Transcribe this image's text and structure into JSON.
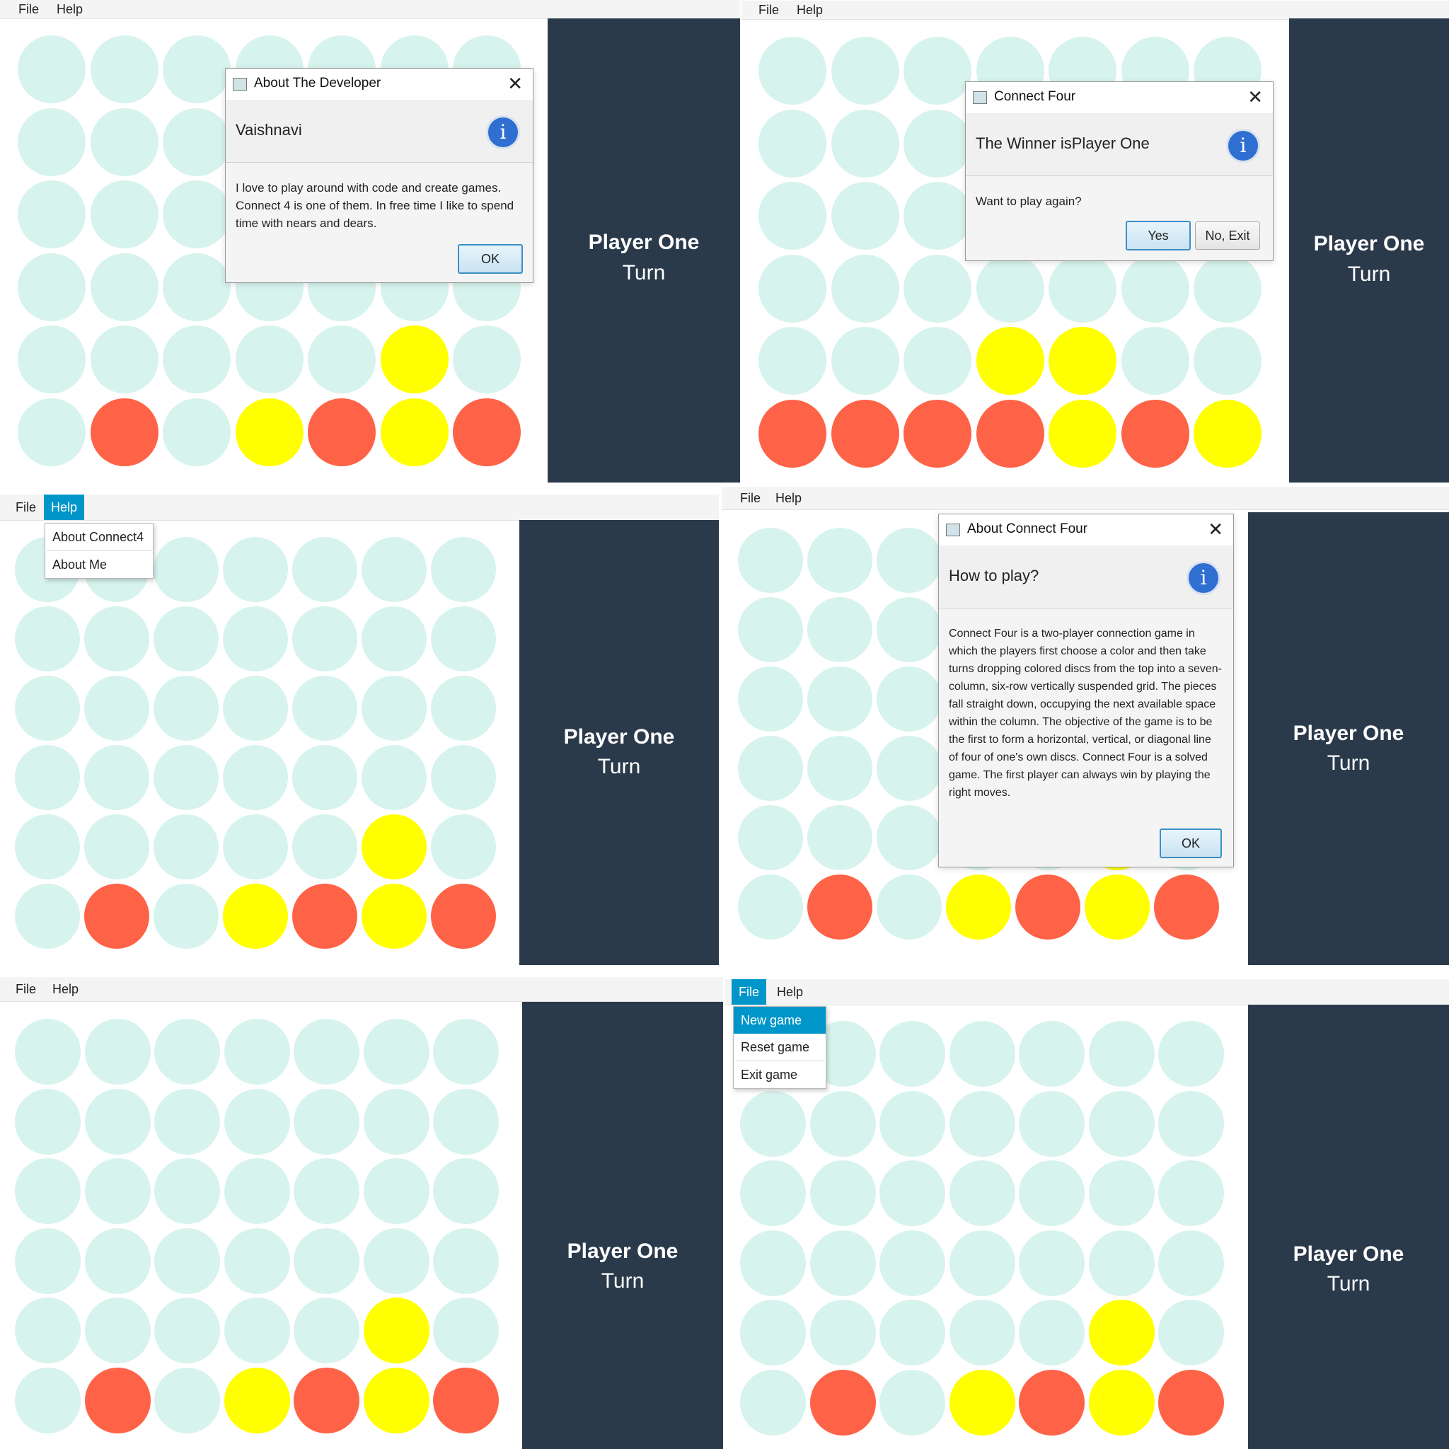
{
  "menus": {
    "file": "File",
    "help": "Help"
  },
  "sidebar": {
    "player": "Player One",
    "turn": "Turn"
  },
  "window_title": "Connect Four",
  "colors": {
    "empty": "#d7f3ee",
    "red": "#ff6347",
    "yellow": "#ffff00",
    "sidebar": "#2b3a4b",
    "accent": "#0096c9"
  },
  "boards": {
    "a": [
      [
        "e",
        "e",
        "e",
        "e",
        "e",
        "e",
        "e"
      ],
      [
        "e",
        "e",
        "e",
        "e",
        "e",
        "e",
        "e"
      ],
      [
        "e",
        "e",
        "e",
        "e",
        "e",
        "e",
        "e"
      ],
      [
        "e",
        "e",
        "e",
        "e",
        "e",
        "e",
        "e"
      ],
      [
        "e",
        "e",
        "e",
        "e",
        "e",
        "y",
        "e"
      ],
      [
        "e",
        "r",
        "e",
        "y",
        "r",
        "y",
        "r"
      ]
    ],
    "b": [
      [
        "e",
        "e",
        "e",
        "e",
        "e",
        "e",
        "e"
      ],
      [
        "e",
        "e",
        "e",
        "e",
        "e",
        "e",
        "e"
      ],
      [
        "e",
        "e",
        "e",
        "e",
        "e",
        "e",
        "e"
      ],
      [
        "e",
        "e",
        "e",
        "e",
        "e",
        "e",
        "e"
      ],
      [
        "e",
        "e",
        "e",
        "y",
        "y",
        "e",
        "e"
      ],
      [
        "r",
        "r",
        "r",
        "r",
        "y",
        "r",
        "y"
      ]
    ]
  },
  "dialog_developer": {
    "title": "About The Developer",
    "header": "Vaishnavi",
    "body": "I love to play around with code and create games. Connect 4 is one of them. In free time I like to spend time with nears and dears.",
    "ok": "OK"
  },
  "dialog_winner": {
    "title": "Connect Four",
    "header": "The Winner isPlayer One",
    "body": "Want to play again?",
    "yes": "Yes",
    "no": "No, Exit"
  },
  "help_menu": {
    "items": [
      "About Connect4",
      "About Me"
    ]
  },
  "dialog_about": {
    "title": "About Connect Four",
    "header": "How to play?",
    "body": "Connect Four is a two-player connection game in which the players first choose a color and then take turns dropping colored discs from the top into a seven-column, six-row vertically suspended grid. The pieces fall straight down, occupying the next available space within the column. The objective of the game is to be the first to form a horizontal, vertical, or diagonal line of four of one's own discs. Connect Four is a solved game. The first player can always win by playing the right moves.",
    "ok": "OK"
  },
  "file_menu": {
    "items": [
      "New game",
      "Reset game",
      "Exit game"
    ]
  }
}
